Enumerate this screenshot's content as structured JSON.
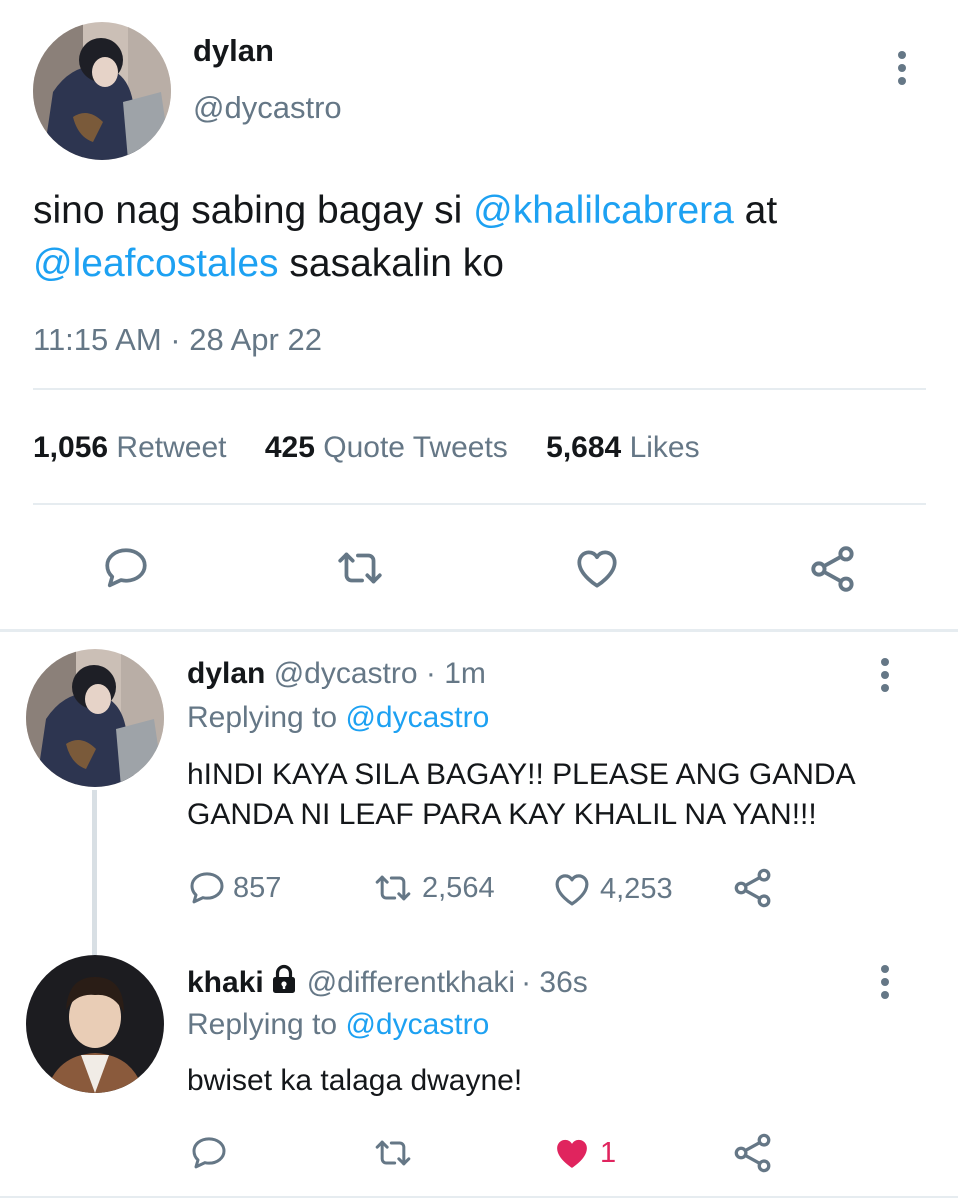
{
  "main_tweet": {
    "display_name": "dylan",
    "handle": "@dycastro",
    "text_part1": "sino nag sabing bagay si ",
    "mention1": "@khalilcabrera",
    "text_part2": " at",
    "mention2": "@leafcostales",
    "text_part3": " sasakalin ko",
    "timestamp": "11:15 AM · 28 Apr 22",
    "stats": {
      "retweets_count": "1,056",
      "retweets_label": "Retweet",
      "quotes_count": "425",
      "quotes_label": "Quote Tweets",
      "likes_count": "5,684",
      "likes_label": "Likes"
    },
    "actions": [
      "reply-icon",
      "retweet-icon",
      "like-icon",
      "share-icon"
    ]
  },
  "replies": [
    {
      "display_name": "dylan",
      "handle": "@dycastro",
      "time": "· 1m",
      "replying_prefix": "Replying to ",
      "replying_handle": "@dycastro",
      "text_line1": "hINDI KAYA SILA BAGAY!! PLEASE ANG GANDA",
      "text_line2": "GANDA NI LEAF PARA KAY KHALIL NA YAN!!!",
      "reply_count": "857",
      "retweet_count": "2,564",
      "like_count": "4,253",
      "liked": false
    },
    {
      "display_name": "khaki",
      "protected_icon": "lock-icon",
      "handle": "@differentkhaki",
      "time": "· 36s",
      "replying_prefix": "Replying to ",
      "replying_handle": "@dycastro",
      "text_line1": "bwiset ka talaga dwayne!",
      "reply_count": "",
      "retweet_count": "",
      "like_count": "1",
      "liked": true
    }
  ],
  "colors": {
    "accent": "#1da1f2",
    "muted": "#657786",
    "like_active": "#e0245e",
    "divider": "#e6ecf0"
  }
}
